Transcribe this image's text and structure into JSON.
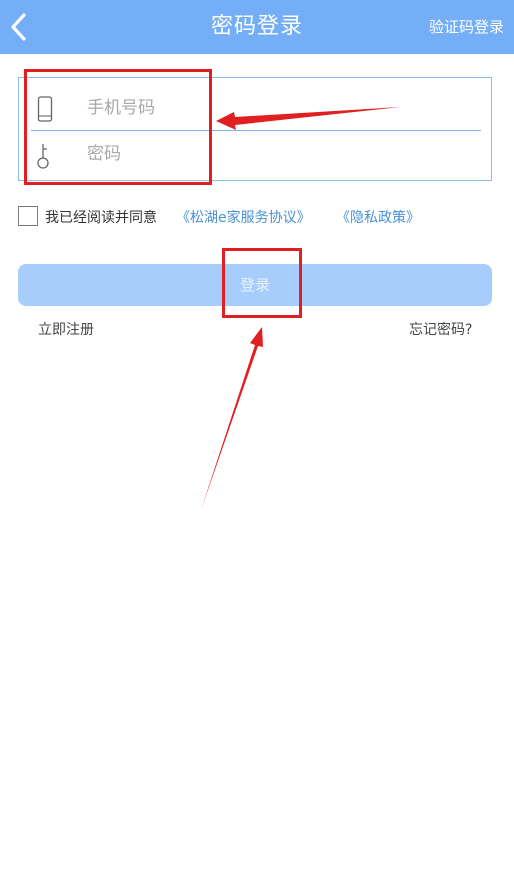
{
  "header": {
    "title": "密码登录",
    "right_link": "验证码登录",
    "back_icon": "chevron-left-icon",
    "background": "#73aef7"
  },
  "form": {
    "phone": {
      "placeholder": "手机号码",
      "value": "",
      "icon": "phone-icon"
    },
    "password": {
      "placeholder": "密码",
      "value": "",
      "icon": "key-icon"
    }
  },
  "agreement": {
    "checked": false,
    "text": "我已经阅读并同意",
    "service_link": "《松湖e家服务协议》",
    "privacy_link": "《隐私政策》"
  },
  "login_button": {
    "label": "登录",
    "color": "#a6cdfb"
  },
  "register_link": "立即注册",
  "forgot_link": "忘记密码?",
  "annotation": {
    "color": "#e02020"
  }
}
